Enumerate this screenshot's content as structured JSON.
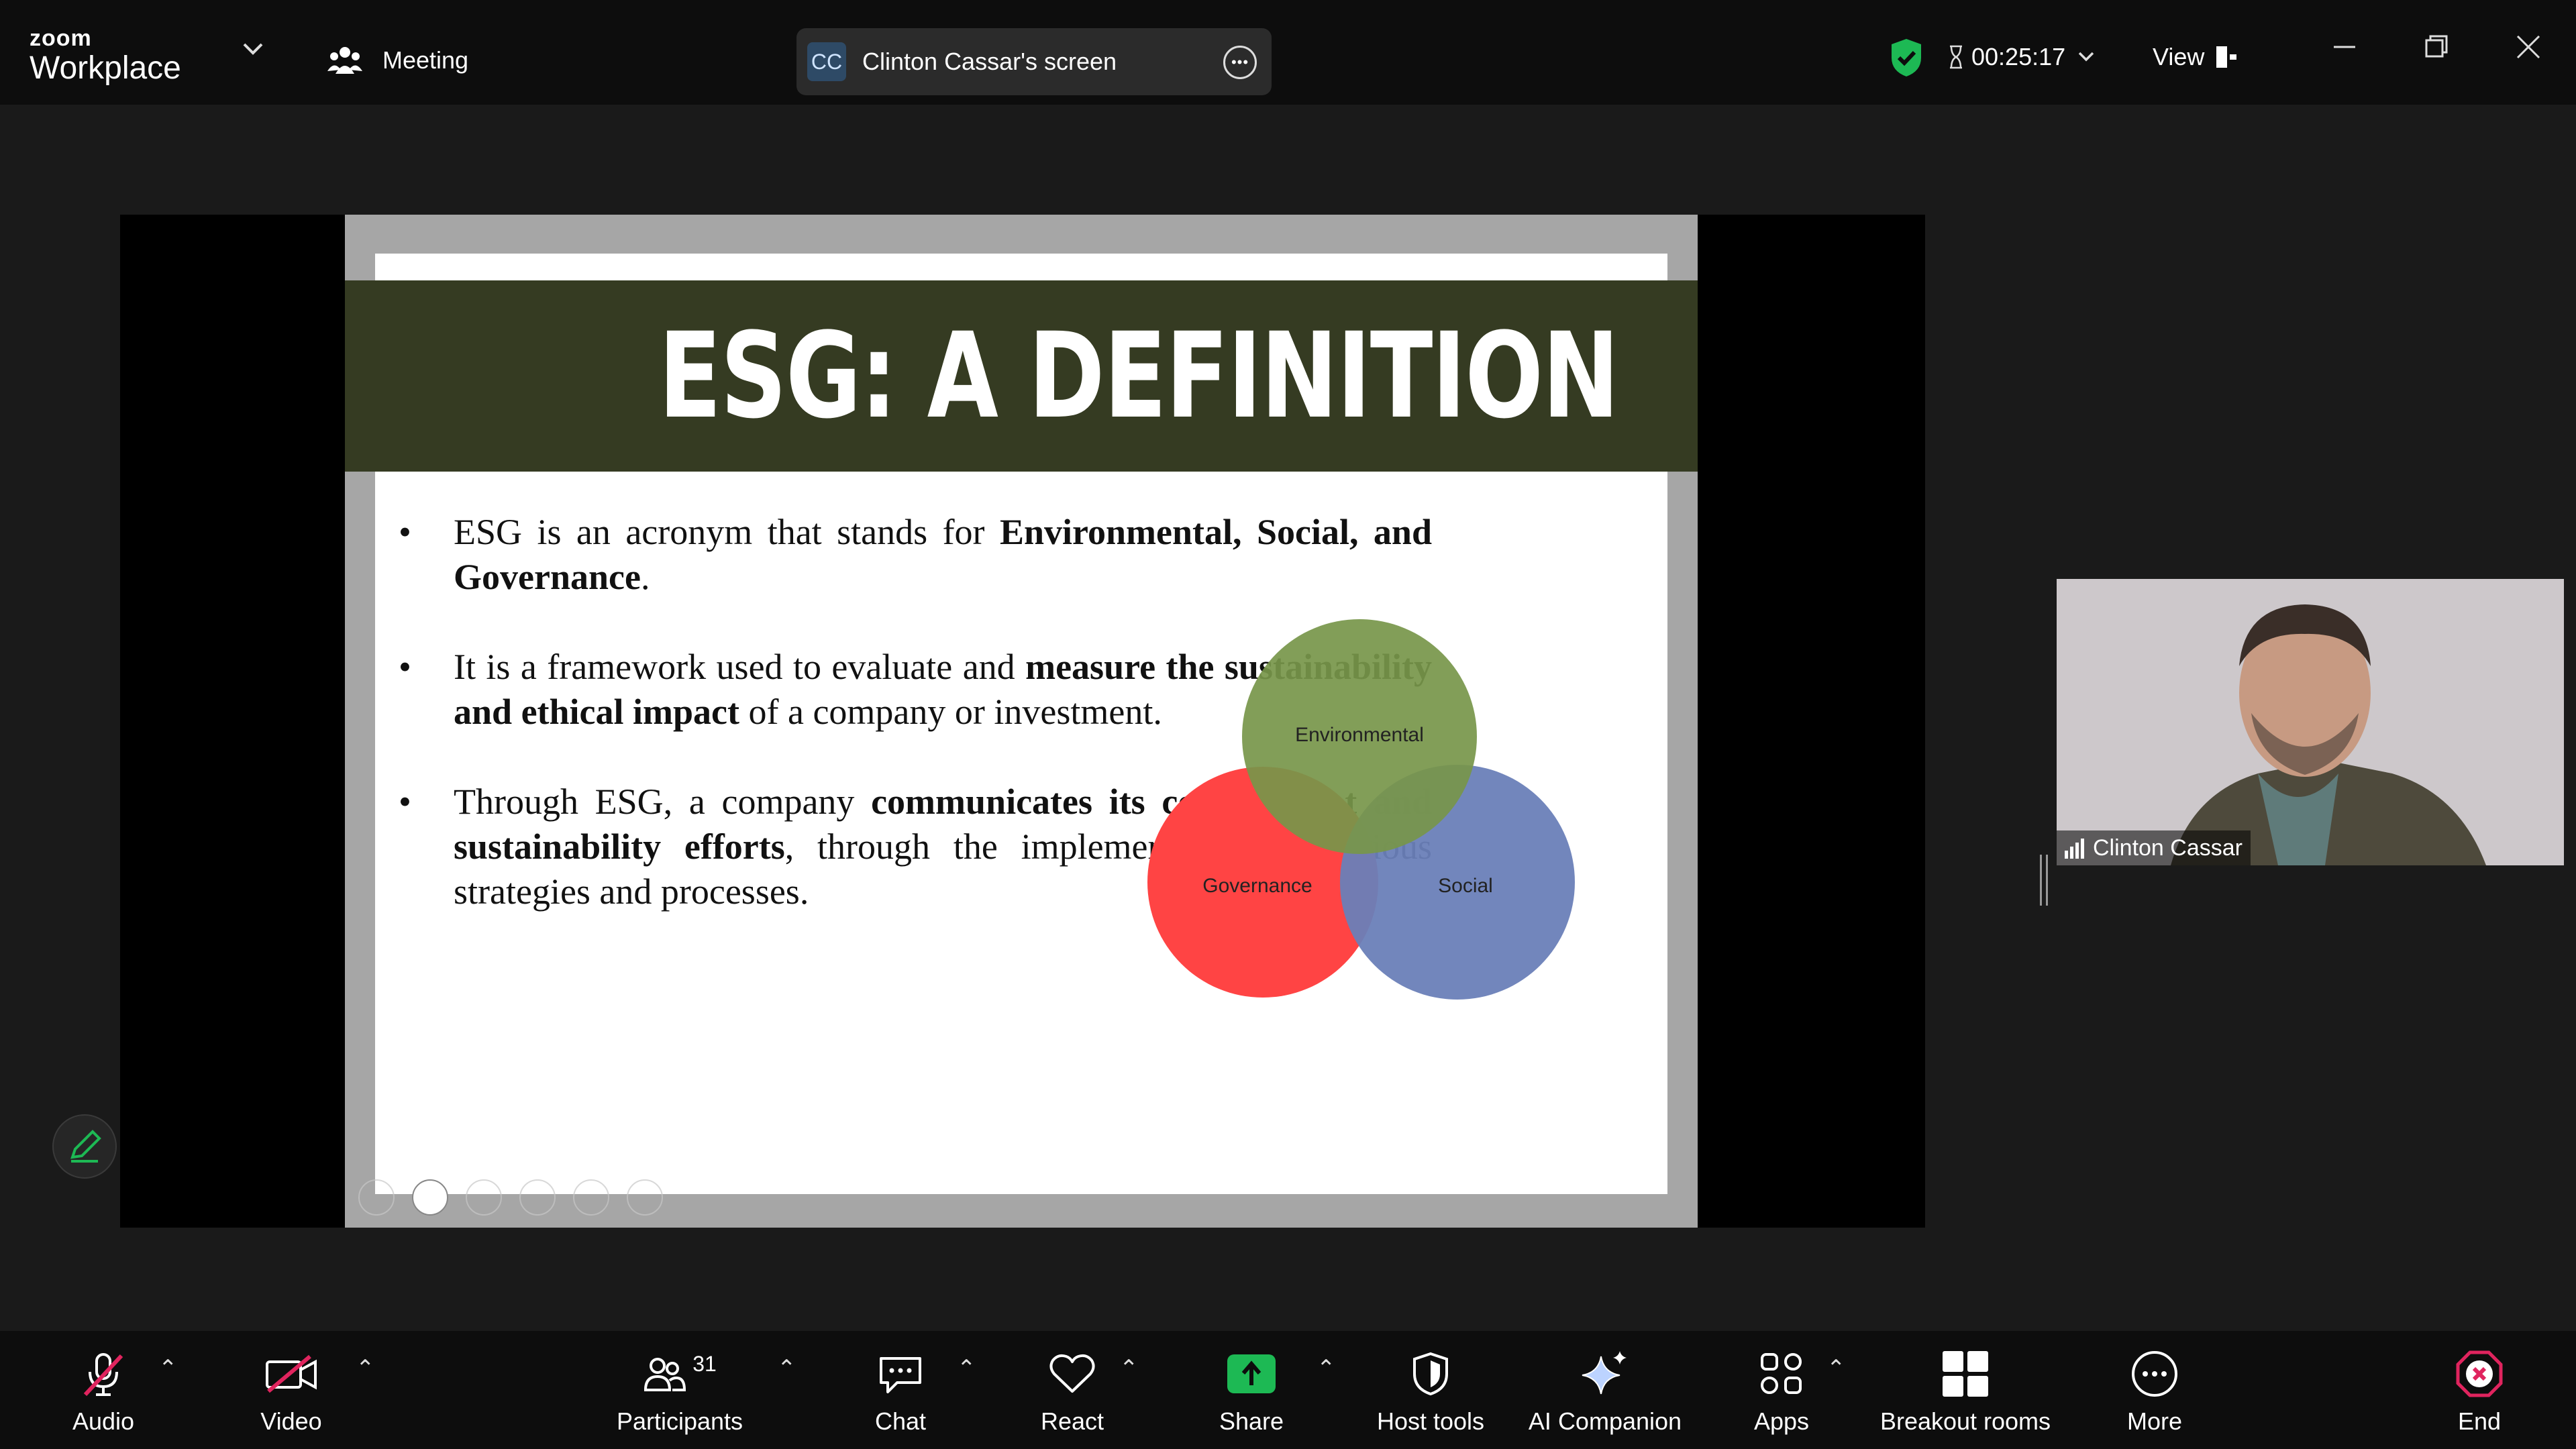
{
  "topbar": {
    "logo_line1": "zoom",
    "logo_line2": "Workplace",
    "meeting_label": "Meeting",
    "share_initials": "CC",
    "share_label": "Clinton Cassar's screen",
    "timer": "00:25:17",
    "view_label": "View"
  },
  "slide": {
    "title": "ESG: A DEFINITION",
    "bullet1_a": "ESG is an acronym that stands for ",
    "bullet1_b": "Environmental, Social, and Governance",
    "bullet1_c": ".",
    "bullet2_a": "It is a framework used to evaluate and ",
    "bullet2_b": "measure the sustainability and ethical impact",
    "bullet2_c": " of a company or investment.",
    "bullet3_a": "Through ESG, a company ",
    "bullet3_b": "communicates its commitment and sustainability efforts",
    "bullet3_c": ", through the implementation of various strategies and processes.",
    "venn": {
      "environmental": "Environmental",
      "governance": "Governance",
      "social": "Social",
      "colors": {
        "environmental": "#77964a",
        "governance": "#ff4444",
        "social": "#6a7fb8"
      }
    }
  },
  "participant": {
    "name": "Clinton Cassar"
  },
  "toolbar": {
    "audio": "Audio",
    "video": "Video",
    "participants": "Participants",
    "participants_count": "31",
    "chat": "Chat",
    "react": "React",
    "share": "Share",
    "host_tools": "Host tools",
    "ai_companion": "AI Companion",
    "apps": "Apps",
    "breakout": "Breakout rooms",
    "more": "More",
    "end": "End"
  },
  "colors": {
    "share_green": "#1db954",
    "end_red": "#e0245e",
    "secure_green": "#1db954"
  }
}
